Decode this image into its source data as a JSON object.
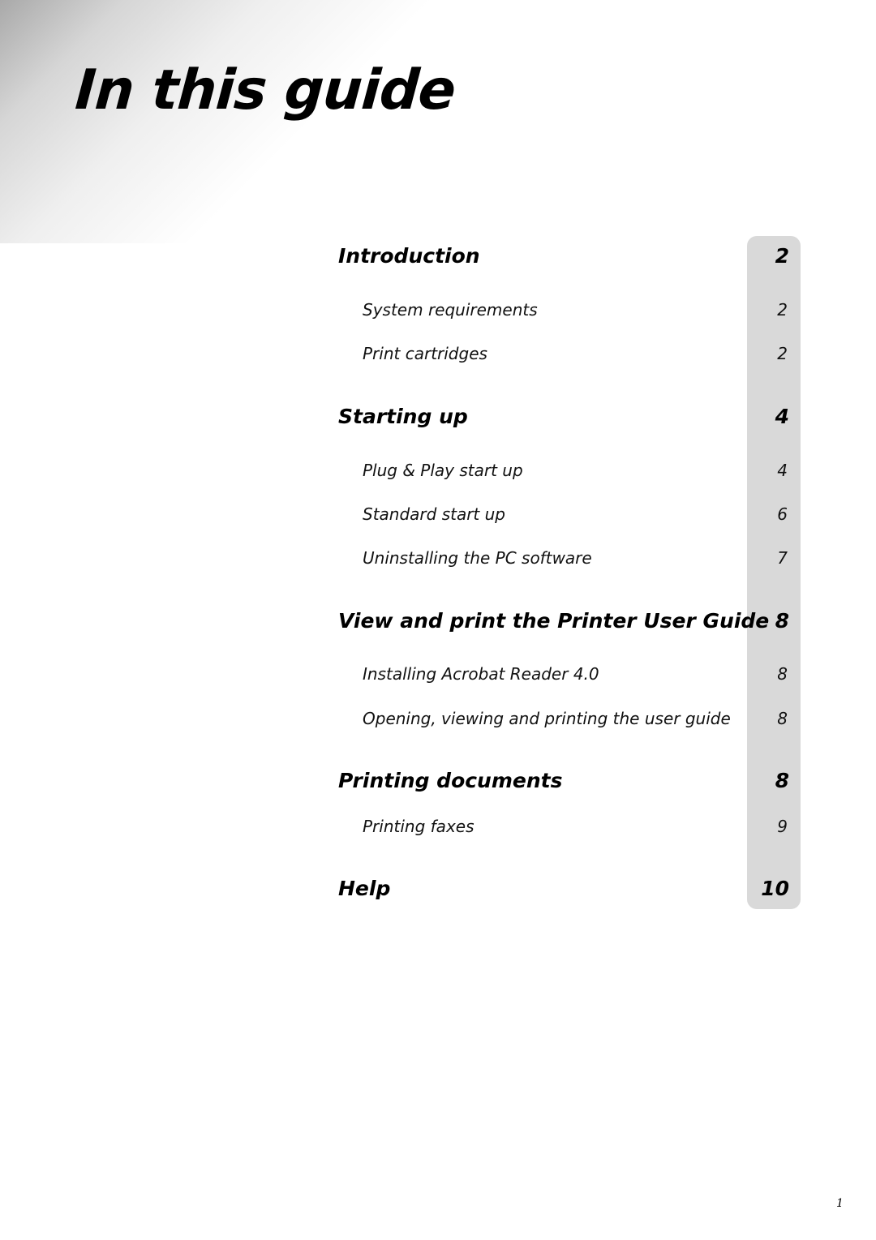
{
  "title": "In this guide",
  "toc": {
    "sections": [
      {
        "title": "Introduction",
        "page": "2",
        "items": [
          {
            "title": "System requirements",
            "page": "2"
          },
          {
            "title": "Print cartridges",
            "page": "2"
          }
        ]
      },
      {
        "title": "Starting up",
        "page": "4",
        "items": [
          {
            "title": "Plug & Play start up",
            "page": "4"
          },
          {
            "title": "Standard start up",
            "page": "6"
          },
          {
            "title": "Uninstalling the PC software",
            "page": "7"
          }
        ]
      },
      {
        "title": "View and print the Printer User Guide",
        "page": "8",
        "items": [
          {
            "title": "Installing Acrobat Reader 4.0",
            "page": "8"
          },
          {
            "title": "Opening, viewing and printing the user guide",
            "page": "8"
          }
        ]
      },
      {
        "title": "Printing documents",
        "page": "8",
        "items": [
          {
            "title": "Printing faxes",
            "page": "9"
          }
        ]
      },
      {
        "title": "Help",
        "page": "10",
        "items": []
      }
    ]
  },
  "footer": {
    "page_number": "1"
  }
}
